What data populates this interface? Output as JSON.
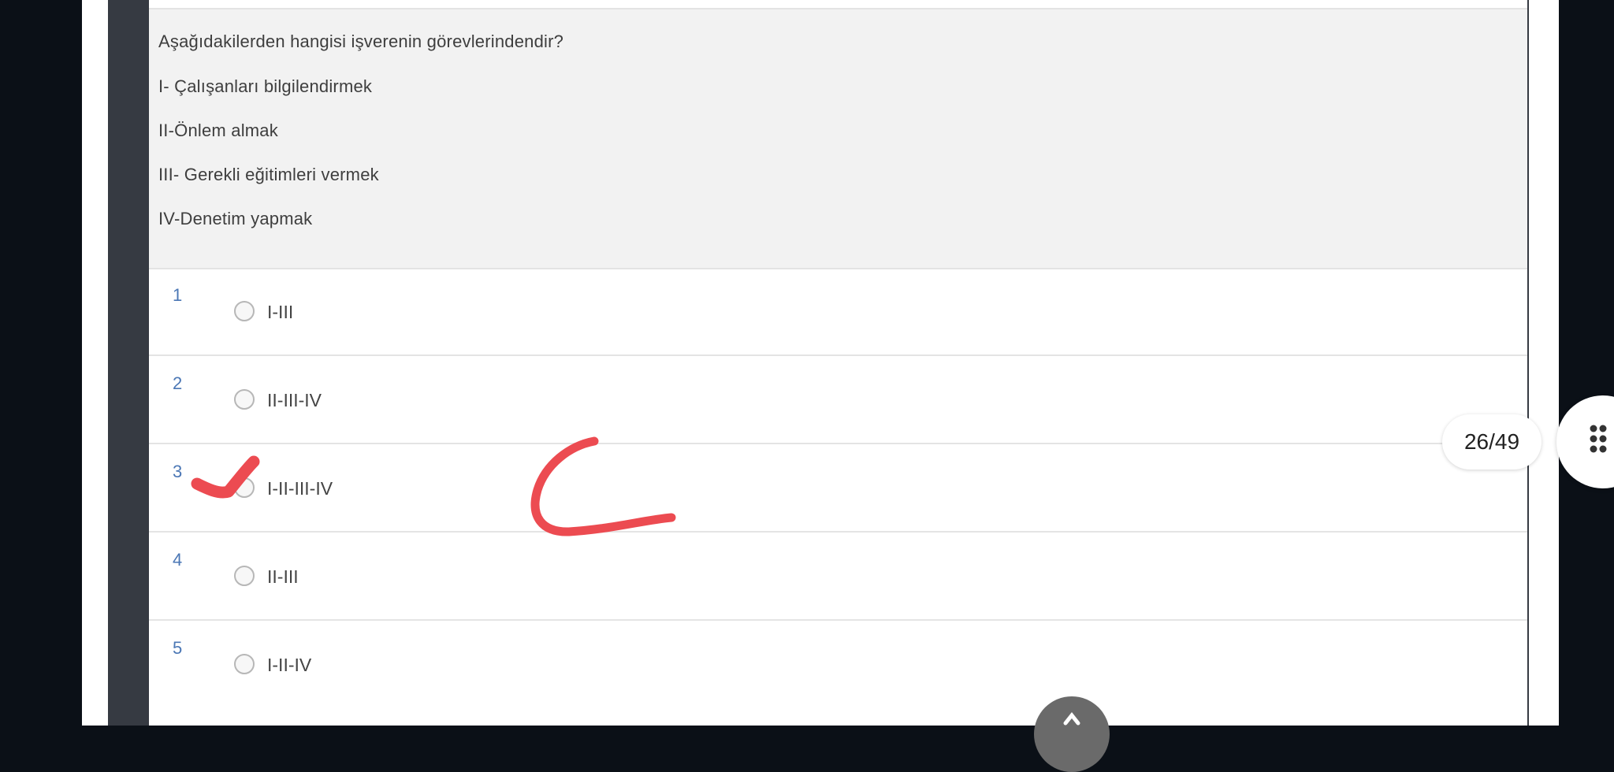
{
  "question": {
    "prompt": "Aşağıdakilerden hangisi işverenin görevlerindendir?",
    "items": [
      "I- Çalışanları bilgilendirmek",
      "II-Önlem almak",
      "III- Gerekli eğitimleri vermek",
      "IV-Denetim yapmak"
    ]
  },
  "options": [
    {
      "number": "1",
      "label": "I-III"
    },
    {
      "number": "2",
      "label": "II-III-IV"
    },
    {
      "number": "3",
      "label": "I-II-III-IV"
    },
    {
      "number": "4",
      "label": "II-III"
    },
    {
      "number": "5",
      "label": "I-II-IV"
    }
  ],
  "counter": "26/49",
  "icons": {
    "menu": "grid-dots-icon",
    "scroll_top": "arrow-up-icon",
    "checkmark": "checkmark-annotation",
    "letter": "letter-c-annotation"
  },
  "colors": {
    "annotation": "#ec4b51",
    "option_number": "#4b77b5",
    "frame": "#363a42",
    "question_bg": "#f2f2f2"
  }
}
